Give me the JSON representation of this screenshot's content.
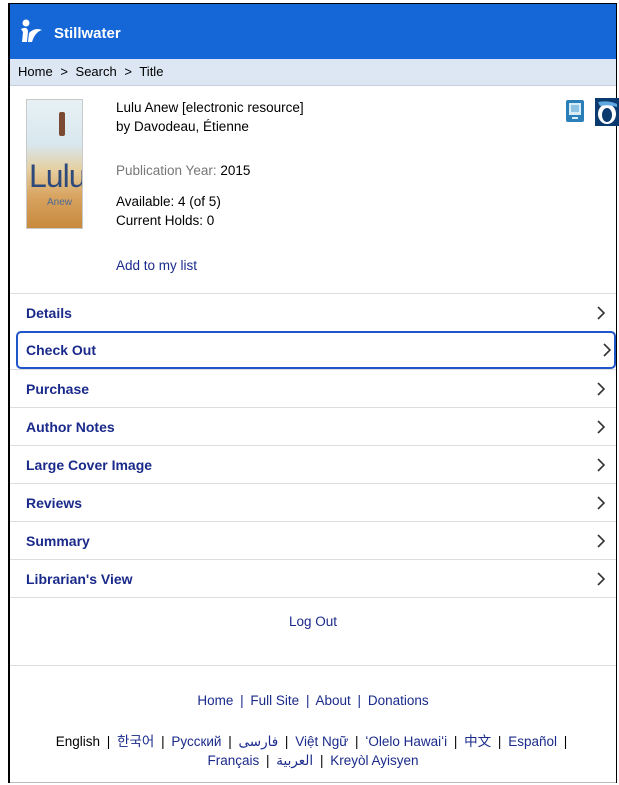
{
  "header": {
    "brand": "Stillwater",
    "bg_color": "#1566d6",
    "logo_icon": "library-logo-icon"
  },
  "breadcrumb": {
    "items": [
      "Home",
      "Search",
      "Title"
    ],
    "separator": ">"
  },
  "record": {
    "title": "Lulu Anew [electronic resource]",
    "author": "by Davodeau, Étienne",
    "pub_year_label": "Publication Year:",
    "pub_year_value": "2015",
    "available": "Available: 4 (of 5)",
    "holds": "Current Holds: 0",
    "add_to_list": "Add to my list",
    "cover_title": "Lulu",
    "cover_subtitle": "Anew",
    "format_icon": "ebook-icon",
    "provider_icon": "overdrive-icon"
  },
  "menu": {
    "items": [
      "Details",
      "Check Out",
      "Purchase",
      "Author Notes",
      "Large Cover Image",
      "Reviews",
      "Summary",
      "Librarian's View"
    ]
  },
  "logout": "Log Out",
  "footer": {
    "links": [
      "Home",
      "Full Site",
      "About",
      "Donations"
    ],
    "separator": "|"
  },
  "languages": {
    "current": "English",
    "row1": [
      "한국어",
      "Русский",
      "فارسی",
      "Việt Ngữ",
      "ʻOlelo Hawaiʻi",
      "中文",
      "Español"
    ],
    "row2": [
      "Français",
      "العربية",
      "Kreyòl Ayisyen"
    ]
  }
}
